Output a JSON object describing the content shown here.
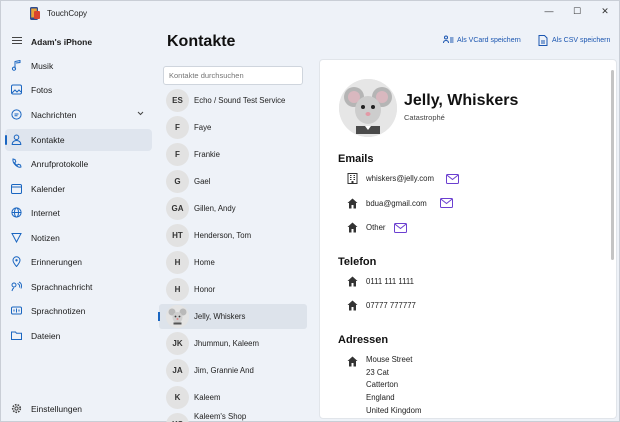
{
  "app": {
    "title": "TouchCopy",
    "device": "Adam's iPhone"
  },
  "window_controls": {
    "minimize": "—",
    "maximize": "☐",
    "close": "✕"
  },
  "sidebar": {
    "items": [
      {
        "label": "Musik",
        "icon": "music-note-icon"
      },
      {
        "label": "Fotos",
        "icon": "photo-icon"
      },
      {
        "label": "Nachrichten",
        "icon": "chat-bubble-icon"
      },
      {
        "label": "Kontakte",
        "icon": "person-icon",
        "active": true
      },
      {
        "label": "Anrufprotokolle",
        "icon": "phone-icon"
      },
      {
        "label": "Kalender",
        "icon": "calendar-icon"
      },
      {
        "label": "Internet",
        "icon": "globe-icon"
      },
      {
        "label": "Notizen",
        "icon": "note-icon"
      },
      {
        "label": "Erinnerungen",
        "icon": "pin-icon"
      },
      {
        "label": "Sprachnachricht",
        "icon": "voicemail-icon"
      },
      {
        "label": "Sprachnotizen",
        "icon": "voice-memo-icon"
      },
      {
        "label": "Dateien",
        "icon": "folder-icon"
      }
    ],
    "settings": "Einstellungen"
  },
  "header": {
    "title": "Kontakte",
    "save_vcard": "Als VCard speichern",
    "save_csv": "Als CSV speichern"
  },
  "search": {
    "placeholder": "Kontakte durchsuchen"
  },
  "contacts": [
    {
      "initials": "ES",
      "name": "Echo / Sound Test Service"
    },
    {
      "initials": "F",
      "name": "Faye"
    },
    {
      "initials": "F",
      "name": "Frankie"
    },
    {
      "initials": "G",
      "name": "Gael"
    },
    {
      "initials": "GA",
      "name": "Gillen, Andy"
    },
    {
      "initials": "HT",
      "name": "Henderson, Tom"
    },
    {
      "initials": "H",
      "name": "Home"
    },
    {
      "initials": "H",
      "name": "Honor"
    },
    {
      "initials": "",
      "name": "Jelly, Whiskers",
      "selected": true
    },
    {
      "initials": "JK",
      "name": "Jhummun, Kaleem"
    },
    {
      "initials": "JA",
      "name": "Jim, Grannie And"
    },
    {
      "initials": "K",
      "name": "Kaleem"
    },
    {
      "initials": "KS",
      "name": "Kaleem's Shop"
    }
  ],
  "detail": {
    "name": "Jelly, Whiskers",
    "company": "Catastrophé",
    "emails_title": "Emails",
    "emails": [
      {
        "type": "work",
        "value": "whiskers@jelly.com"
      },
      {
        "type": "home",
        "value": "bdua@gmail.com"
      },
      {
        "type": "home",
        "value": "Other"
      }
    ],
    "phone_title": "Telefon",
    "phones": [
      {
        "type": "home",
        "value": "0111 111 1111"
      },
      {
        "type": "home",
        "value": "07777 777777"
      }
    ],
    "address_title": "Adressen",
    "address_lines": [
      "Mouse Street",
      "23 Cat",
      "Catterton",
      "England",
      "United Kingdom"
    ]
  },
  "colors": {
    "accent": "#1a66c1",
    "mail_icon": "#6b3fd0",
    "link": "#1a55b0"
  }
}
